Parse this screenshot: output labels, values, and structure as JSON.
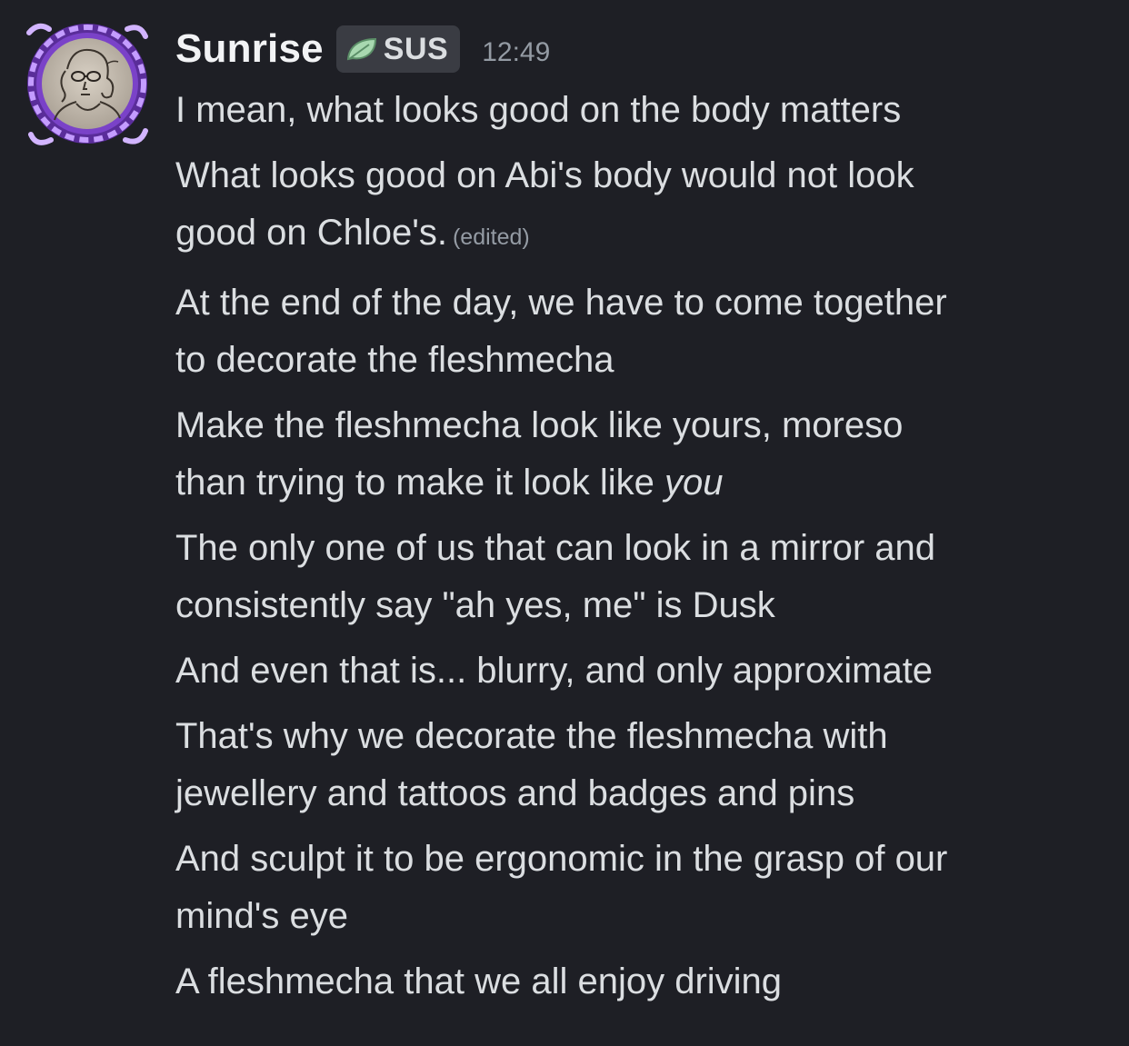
{
  "author": {
    "name": "Sunrise",
    "tag": "SUS",
    "tag_icon": "leaf-icon",
    "timestamp": "12:49",
    "avatar": "framed-portrait-avatar"
  },
  "colors": {
    "background": "#1e1f25",
    "text": "#dbdee1",
    "muted": "#949ba4",
    "tag_bg": "#3a3c43",
    "frame": "#a86bf0"
  },
  "messages": [
    {
      "lines": [
        "I mean, what looks good on the body matters"
      ]
    },
    {
      "lines": [
        "What looks good on Abi's body would not look",
        "good on Chloe's."
      ],
      "edited": "(edited)"
    },
    {
      "lines": [
        "At the end of the day, we have to come together",
        "to decorate the fleshmecha"
      ]
    },
    {
      "lines": [
        "Make the fleshmecha look like yours, moreso",
        "than trying to make it look like "
      ],
      "emphasis": "you"
    },
    {
      "lines": [
        "The only one of us that can look in a mirror and",
        "consistently say \"ah yes, me\" is Dusk"
      ]
    },
    {
      "lines": [
        "And even that is... blurry, and only approximate"
      ]
    },
    {
      "lines": [
        "That's why we decorate the fleshmecha with",
        "jewellery and tattoos and badges and pins"
      ]
    },
    {
      "lines": [
        "And sculpt it to be ergonomic in the grasp of our",
        "mind's eye"
      ]
    },
    {
      "lines": [
        "A fleshmecha that we all enjoy driving"
      ]
    }
  ]
}
